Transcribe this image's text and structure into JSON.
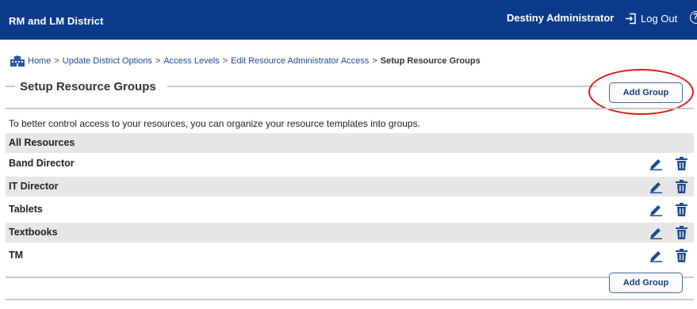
{
  "header": {
    "district": "RM and LM District",
    "user": "Destiny Administrator",
    "logout_label": "Log Out",
    "help_glyph": "?"
  },
  "breadcrumb": {
    "home_icon": "district-building-icon",
    "items": [
      "Home",
      "Update District Options",
      "Access Levels",
      "Edit Resource Administrator Access"
    ],
    "separator": ">",
    "current": "Setup Resource Groups"
  },
  "section": {
    "title": "Setup Resource Groups",
    "add_group_label": "Add Group",
    "intro": "To better control access to your resources, you can organize your resource templates into groups."
  },
  "groups": {
    "all_resources": "All Resources",
    "rows": [
      {
        "name": "Band Director"
      },
      {
        "name": "IT Director"
      },
      {
        "name": "Tablets"
      },
      {
        "name": "Textbooks"
      },
      {
        "name": "TM"
      }
    ]
  },
  "icons": {
    "edit": "pencil-icon",
    "delete": "trash-icon"
  },
  "colors": {
    "header_bg": "#0d3b8c",
    "accent": "#0d3b8c",
    "highlight": "#e01818",
    "row_shade": "#e6e6e6"
  }
}
